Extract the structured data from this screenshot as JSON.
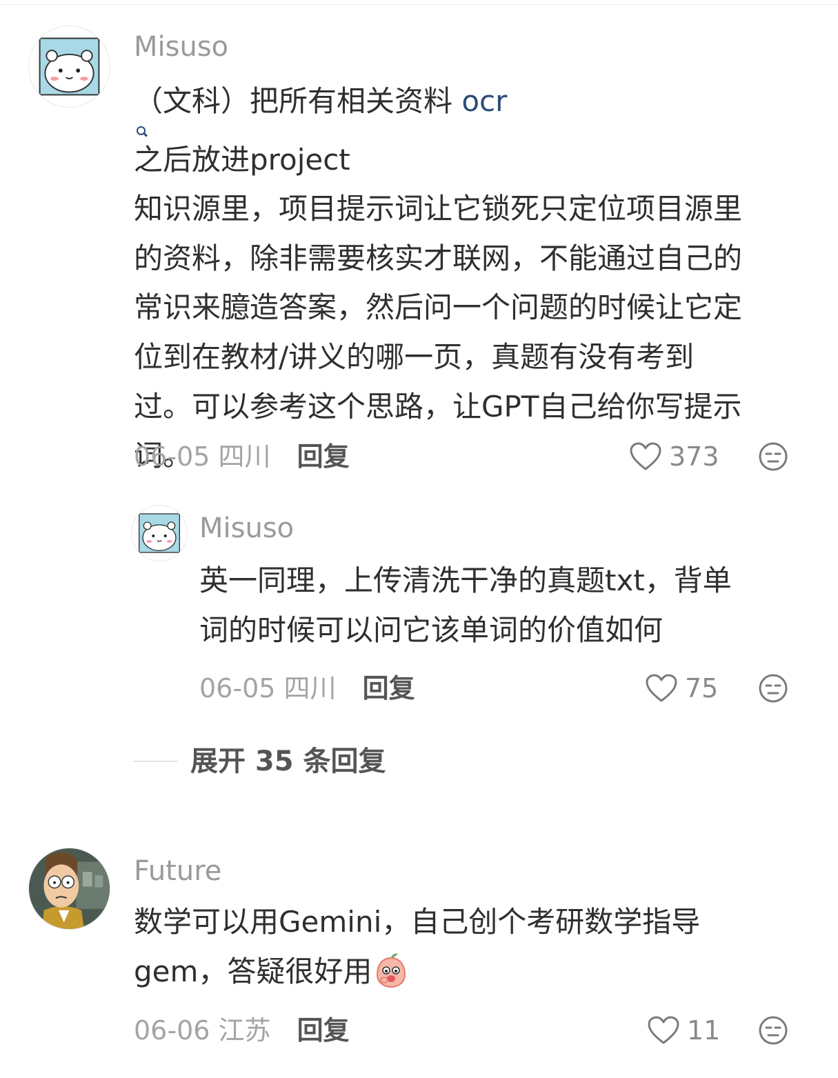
{
  "comments": [
    {
      "username": "Misuso",
      "content": {
        "line1_before": "（文科）把所有相关资料 ",
        "line1_link": "ocr",
        "line1_after": " 之后放进project",
        "lines": [
          "知识源里，项目提示词让它锁死只定位项目源里",
          "的资料，除非需要核实才联网，不能通过自己的",
          "常识来臆造答案，然后问一个问题的时候让它定",
          "位到在教材/讲义的哪一页，真题有没有考到",
          "过。可以参考这个思路，让GPT自己给你写提示",
          "词。"
        ]
      },
      "date": "06-05",
      "location": "四川",
      "reply_label": "回复",
      "likes": "373"
    },
    {
      "username": "Misuso",
      "content": {
        "lines": [
          "英一同理，上传清洗干净的真题txt，背单",
          "词的时候可以问它该单词的价值如何"
        ]
      },
      "date": "06-05",
      "location": "四川",
      "reply_label": "回复",
      "likes": "75"
    },
    {
      "username": "Future",
      "content": {
        "lines": [
          "数学可以用Gemini，自己创个考研数学指导"
        ],
        "last_line": "gem，答疑很好用"
      },
      "date": "06-06",
      "location": "江苏",
      "reply_label": "回复",
      "likes": "11"
    }
  ],
  "expand_replies": "展开 35 条回复",
  "icons": {
    "like": "heart-icon",
    "dislike": "neutral-face-icon",
    "link": "search-icon",
    "emoji": "peach-emoji-icon"
  },
  "colors": {
    "username": "#9a9a9a",
    "link": "#2d4b78",
    "meta": "#a4a4a4",
    "avatar_bg": "#a9d8e6"
  }
}
